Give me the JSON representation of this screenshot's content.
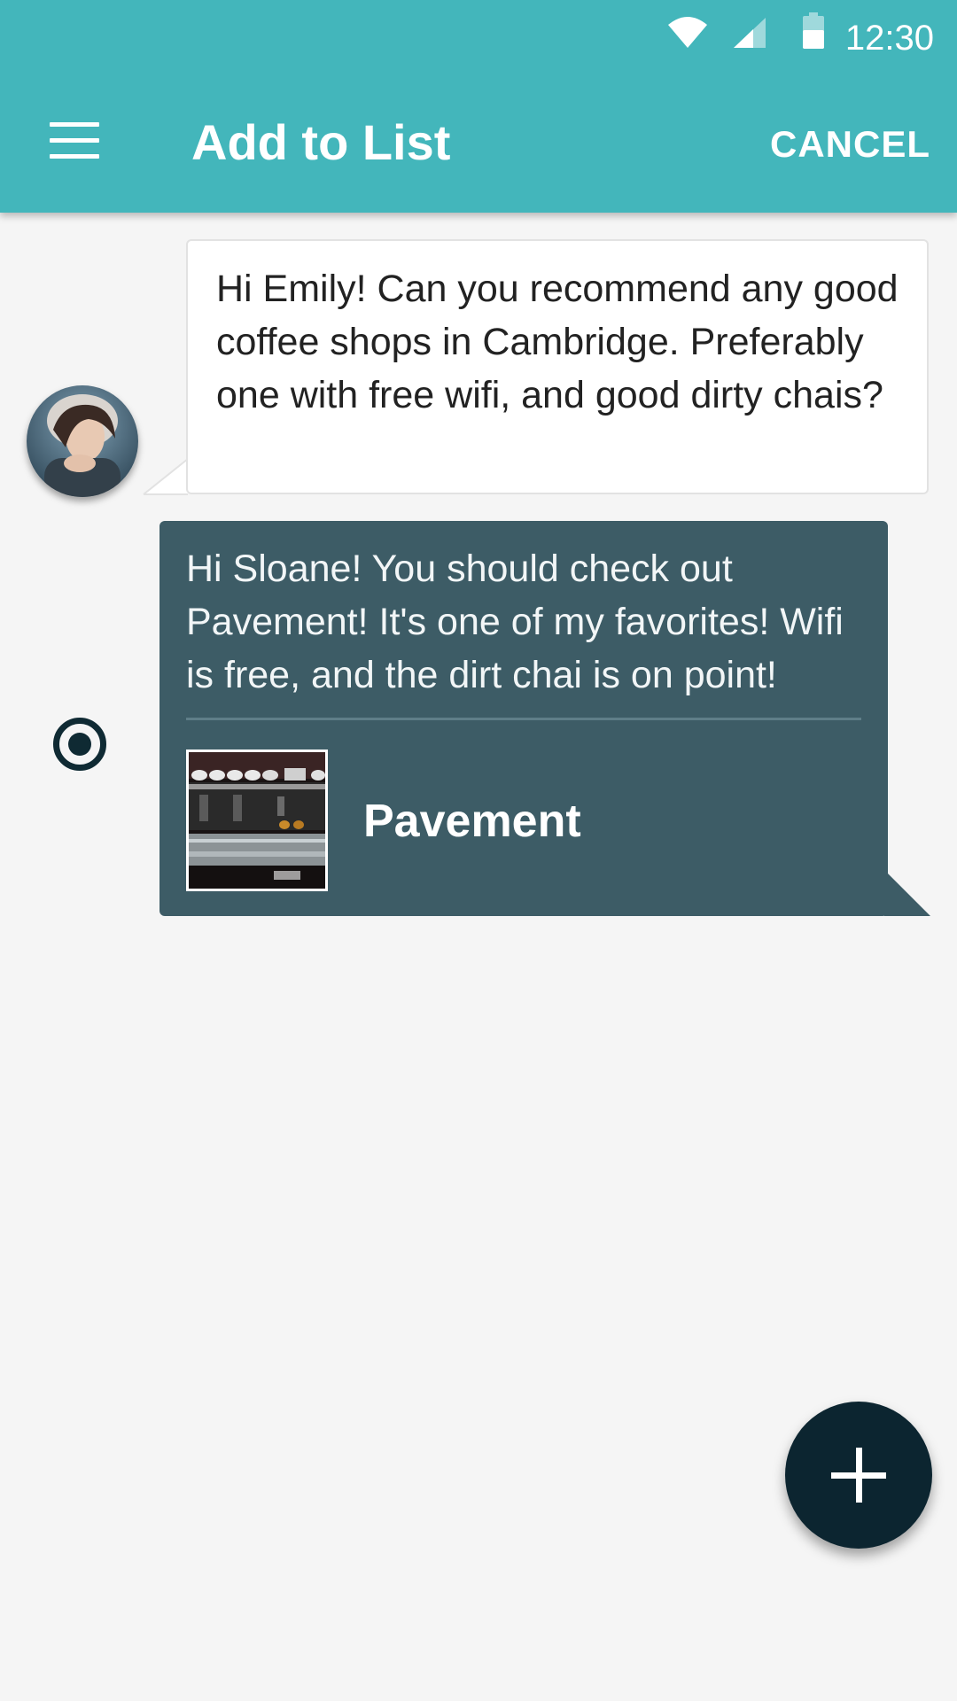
{
  "status_bar": {
    "time": "12:30",
    "icons": [
      "wifi-icon",
      "cell-signal-icon",
      "battery-icon"
    ]
  },
  "app_bar": {
    "menu_icon": "hamburger-menu-icon",
    "title": "Add to List",
    "cancel_label": "CANCEL",
    "background_color": "#43b6bb"
  },
  "messages": [
    {
      "direction": "incoming",
      "text": "Hi Emily! Can you recommend any good coffee shops in Cambridge. Preferably one with free wifi, and good dirty chais?",
      "background_color": "#ffffff"
    },
    {
      "direction": "outgoing",
      "selected": true,
      "text": "Hi Sloane! You should check out Pavement! It's one of my favorites! Wifi is free, and the dirt chai is on point!",
      "attachment": {
        "name": "Pavement"
      },
      "background_color": "#3d5c66"
    }
  ],
  "fab": {
    "icon": "plus-icon",
    "background_color": "#0c2530"
  }
}
